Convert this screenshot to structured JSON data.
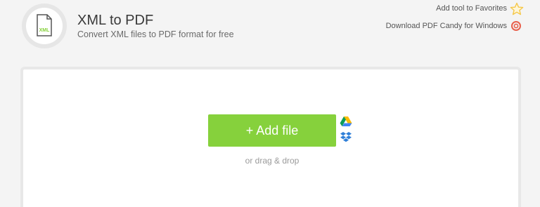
{
  "header": {
    "title": "XML to PDF",
    "subtitle": "Convert XML files to PDF format for free",
    "tool_icon": {
      "name": "xml-file-icon",
      "label": "XML",
      "color": "#86d13c"
    }
  },
  "links": {
    "favorites": {
      "label": "Add tool to Favorites",
      "icon": "star-icon",
      "color": "#f5c84a"
    },
    "windows": {
      "label": "Download PDF Candy for Windows",
      "icon": "candy-icon",
      "color": "#e8604c"
    }
  },
  "upload": {
    "button_label": "+ Add file",
    "button_color": "#86d13c",
    "hint": "or drag & drop",
    "sources": [
      "google-drive-icon",
      "dropbox-icon"
    ]
  }
}
